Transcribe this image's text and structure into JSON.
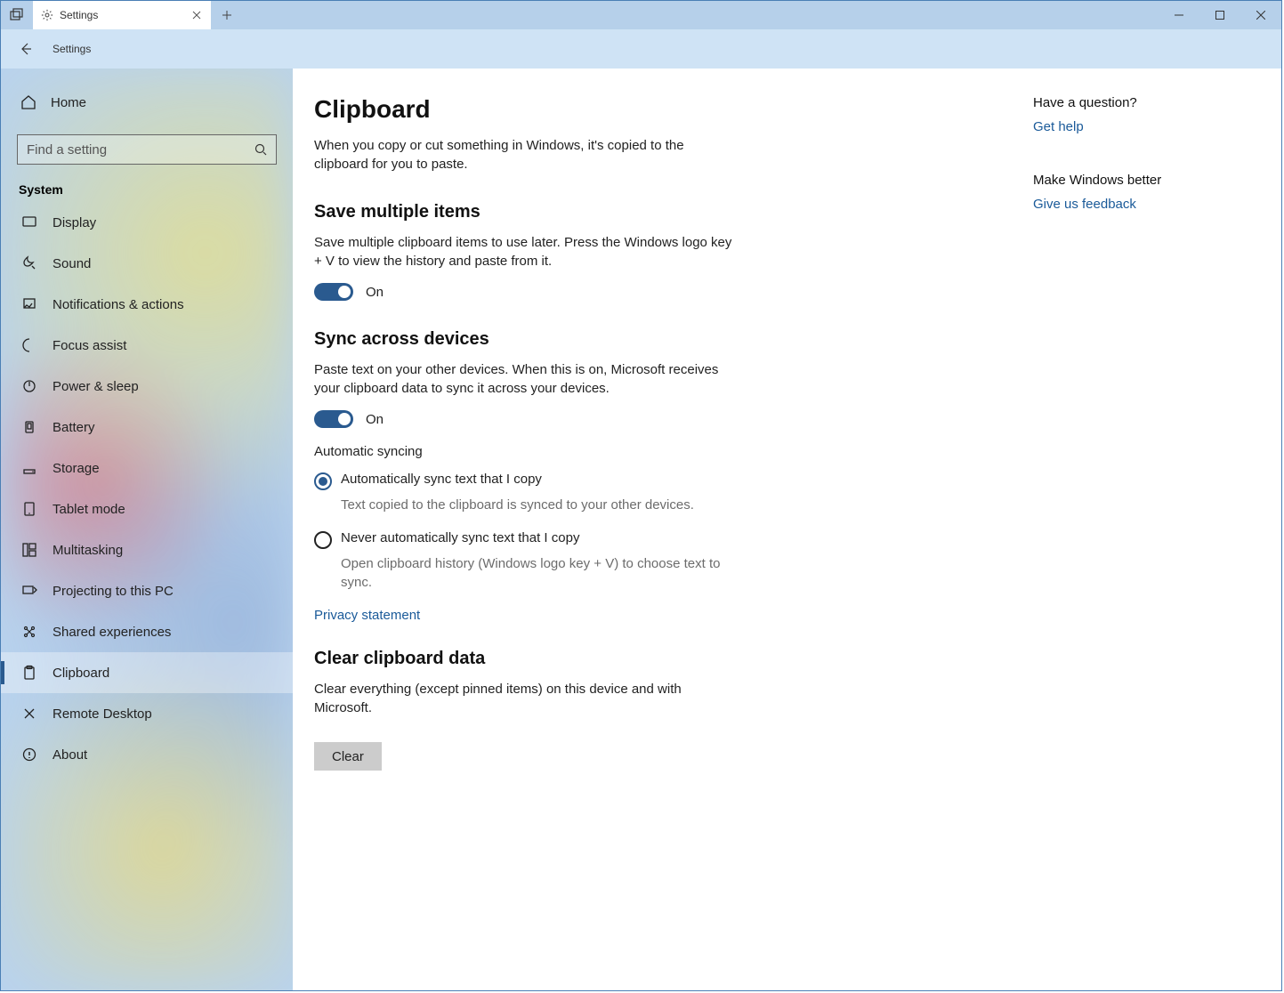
{
  "titlebar": {
    "tab_title": "Settings",
    "app_title": "Settings"
  },
  "sidebar": {
    "home": "Home",
    "search_placeholder": "Find a setting",
    "section": "System",
    "items": [
      {
        "label": "Display"
      },
      {
        "label": "Sound"
      },
      {
        "label": "Notifications & actions"
      },
      {
        "label": "Focus assist"
      },
      {
        "label": "Power & sleep"
      },
      {
        "label": "Battery"
      },
      {
        "label": "Storage"
      },
      {
        "label": "Tablet mode"
      },
      {
        "label": "Multitasking"
      },
      {
        "label": "Projecting to this PC"
      },
      {
        "label": "Shared experiences"
      },
      {
        "label": "Clipboard"
      },
      {
        "label": "Remote Desktop"
      },
      {
        "label": "About"
      }
    ],
    "active_index": 11
  },
  "main": {
    "title": "Clipboard",
    "intro": "When you copy or cut something in Windows, it's copied to the clipboard for you to paste.",
    "save_multiple": {
      "heading": "Save multiple items",
      "desc": "Save multiple clipboard items to use later. Press the Windows logo key + V to view the history and paste from it.",
      "toggle": "On"
    },
    "sync": {
      "heading": "Sync across devices",
      "desc": "Paste text on your other devices. When this is on, Microsoft receives your clipboard data to sync it across your devices.",
      "toggle": "On",
      "auto_heading": "Automatic syncing",
      "opt1": "Automatically sync text that I copy",
      "opt1_desc": "Text copied to the clipboard is synced to your other devices.",
      "opt2": "Never automatically sync text that I copy",
      "opt2_desc": "Open clipboard history (Windows logo key + V) to choose text to sync.",
      "selected": 0
    },
    "privacy_link": "Privacy statement",
    "clear": {
      "heading": "Clear clipboard data",
      "desc": "Clear everything (except pinned items) on this device and with Microsoft.",
      "button": "Clear"
    }
  },
  "right": {
    "q_heading": "Have a question?",
    "get_help": "Get help",
    "better_heading": "Make Windows better",
    "feedback": "Give us feedback"
  }
}
